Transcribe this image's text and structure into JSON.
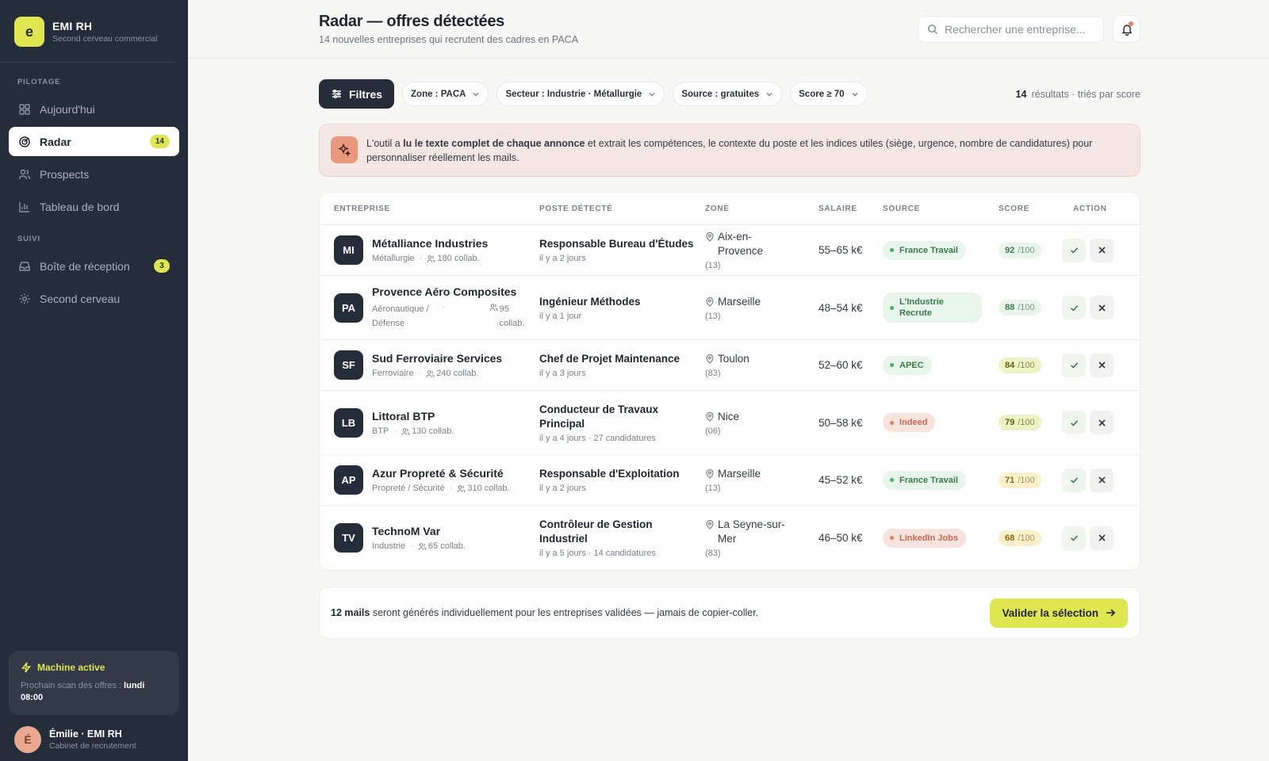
{
  "brand": {
    "logo": "e",
    "title": "EMI RH",
    "subtitle": "Second cerveau commercial"
  },
  "sidebar": {
    "section_pilotage": "PILOTAGE",
    "section_suivi": "SUIVI",
    "items": [
      {
        "label": "Aujourd'hui",
        "icon": "grid-icon"
      },
      {
        "label": "Radar",
        "icon": "radar-icon",
        "badge": "14",
        "active": true
      },
      {
        "label": "Prospects",
        "icon": "users-icon"
      },
      {
        "label": "Tableau de bord",
        "icon": "bar-chart-icon"
      },
      {
        "label": "Boîte de réception",
        "icon": "inbox-icon",
        "badge": "3"
      },
      {
        "label": "Second cerveau",
        "icon": "gear-icon"
      }
    ],
    "machine": {
      "title": "Machine active",
      "text": "Prochain scan des offres :",
      "when": "lundi 08:00"
    },
    "user": {
      "initial": "É",
      "name": "Émilie · EMI RH",
      "role": "Cabinet de recrutement"
    }
  },
  "header": {
    "title": "Radar — offres détectées",
    "subtitle": "14 nouvelles entreprises qui recrutent des cadres en PACA",
    "search_placeholder": "Rechercher une entreprise..."
  },
  "filters": {
    "button": "Filtres",
    "chips": [
      "Zone : PACA",
      "Secteur : Industrie · Métallurgie",
      "Source : gratuites",
      "Score ≥ 70"
    ],
    "result_count": "14",
    "result_suffix": "résultats · triés par score"
  },
  "info": {
    "before": "L'outil a ",
    "bold": "lu le texte complet de chaque annonce",
    "after": " et extrait les compétences, le contexte du poste et les indices utiles (siège, urgence, nombre de candidatures) pour personnaliser réellement les mails."
  },
  "table": {
    "headers": [
      "ENTREPRISE",
      "POSTE DÉTECTÉ",
      "ZONE",
      "SALAIRE",
      "SOURCE",
      "SCORE",
      "ACTION"
    ],
    "rows": [
      {
        "initials": "MI",
        "name": "Métalliance Industries",
        "sector": "Métallurgie",
        "employees": "180 collab.",
        "poste": "Responsable Bureau d'Études",
        "poste_meta": "il y a 2 jours",
        "city": "Aix-en-Provence",
        "dep": "(13)",
        "salary": "55–65 k€",
        "source": "France Travail",
        "source_color": "green",
        "score": "92",
        "score_max": "/100",
        "score_color": "green"
      },
      {
        "initials": "PA",
        "name": "Provence Aéro Composites",
        "sector": "Aéronautique / Défense",
        "employees": "95 collab.",
        "poste": "Ingénieur Méthodes",
        "poste_meta": "il y a 1 jour",
        "city": "Marseille",
        "dep": "(13)",
        "salary": "48–54 k€",
        "source": "L'Industrie Recrute",
        "source_color": "green",
        "score": "88",
        "score_max": "/100",
        "score_color": "green"
      },
      {
        "initials": "SF",
        "name": "Sud Ferroviaire Services",
        "sector": "Ferroviaire",
        "employees": "240 collab.",
        "poste": "Chef de Projet Maintenance",
        "poste_meta": "il y a 3 jours",
        "city": "Toulon",
        "dep": "(83)",
        "salary": "52–60 k€",
        "source": "APEC",
        "source_color": "green",
        "score": "84",
        "score_max": "/100",
        "score_color": "lime"
      },
      {
        "initials": "LB",
        "name": "Littoral BTP",
        "sector": "BTP",
        "employees": "130 collab.",
        "poste": "Conducteur de Travaux Principal",
        "poste_meta": "il y a 4 jours · 27 candidatures",
        "city": "Nice",
        "dep": "(06)",
        "salary": "50–58 k€",
        "source": "Indeed",
        "source_color": "red",
        "score": "79",
        "score_max": "/100",
        "score_color": "lime"
      },
      {
        "initials": "AP",
        "name": "Azur Propreté & Sécurité",
        "sector": "Propreté / Sécurité",
        "employees": "310 collab.",
        "poste": "Responsable d'Exploitation",
        "poste_meta": "il y a 2 jours",
        "city": "Marseille",
        "dep": "(13)",
        "salary": "45–52 k€",
        "source": "France Travail",
        "source_color": "green",
        "score": "71",
        "score_max": "/100",
        "score_color": "amber"
      },
      {
        "initials": "TV",
        "name": "TechnoM Var",
        "sector": "Industrie",
        "employees": "65 collab.",
        "poste": "Contrôleur de Gestion Industriel",
        "poste_meta": "il y a 5 jours · 14 candidatures",
        "city": "La Seyne-sur-Mer",
        "dep": "(83)",
        "salary": "46–50 k€",
        "source": "LinkedIn Jobs",
        "source_color": "red",
        "score": "68",
        "score_max": "/100",
        "score_color": "amber"
      }
    ]
  },
  "footer": {
    "bold": "12 mails",
    "text": " seront générés individuellement pour les entreprises validées — jamais de copier-coller.",
    "button": "Valider la sélection"
  },
  "colors": {
    "sidebar_bg": "#262d3a",
    "accent": "#dfe64f",
    "green_bg": "#e8f5ea",
    "green_fg": "#3d7a4c",
    "red_bg": "#f8e4de",
    "red_fg": "#c96a4f",
    "lime_bg": "#eef3c4",
    "lime_fg": "#5a6010",
    "amber_bg": "#fbf0cc",
    "amber_fg": "#8a6a10"
  }
}
